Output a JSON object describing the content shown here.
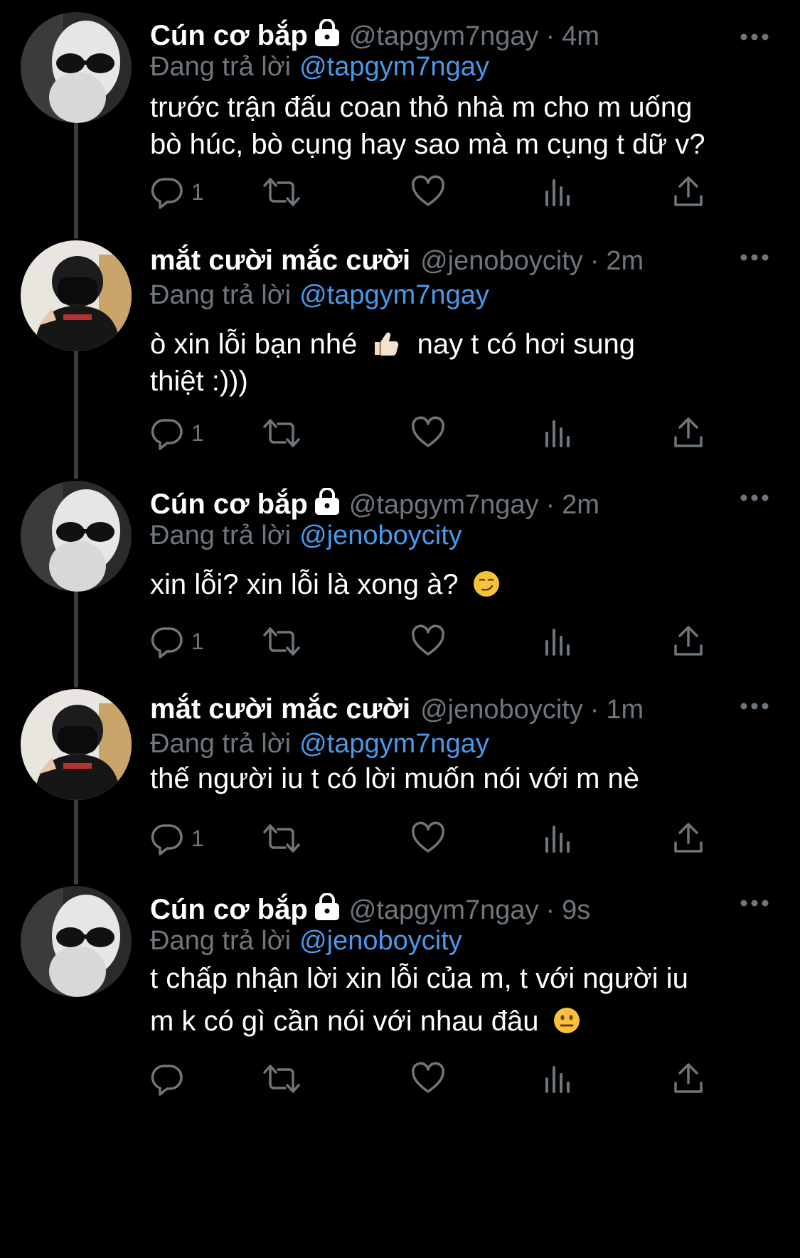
{
  "thread": {
    "tweets": [
      {
        "display_name": "Cún cơ bắp",
        "locked": true,
        "handle": "@tapgym7ngay",
        "dot": "·",
        "time": "4m",
        "reply_prefix": "Đang trả lời",
        "reply_to": "@tapgym7ngay",
        "text_lines": [
          "trước trận đấu coan thỏ nhà m cho m uống",
          "bò húc, bò cụng hay sao mà m cụng t dữ v?"
        ],
        "reply_count": "1",
        "avatar": "dog-avatar"
      },
      {
        "display_name": "mắt cười mắc cười",
        "locked": false,
        "handle": "@jenoboycity",
        "dot": "·",
        "time": "2m",
        "reply_prefix": "Đang trả lời",
        "reply_to": "@tapgym7ngay",
        "text_lines": [
          "ò xin lỗi bạn nhé",
          "nay t có hơi sung",
          "thiệt :)))"
        ],
        "reply_count": "1",
        "avatar": "person-avatar"
      },
      {
        "display_name": "Cún cơ bắp",
        "locked": true,
        "handle": "@tapgym7ngay",
        "dot": "·",
        "time": "2m",
        "reply_prefix": "Đang trả lời",
        "reply_to": "@jenoboycity",
        "text_lines": [
          "xin lỗi? xin lỗi là xong à?"
        ],
        "reply_count": "1",
        "avatar": "dog-avatar"
      },
      {
        "display_name": "mắt cười mắc cười",
        "locked": false,
        "handle": "@jenoboycity",
        "dot": "·",
        "time": "1m",
        "reply_prefix": "Đang trả lời",
        "reply_to": "@tapgym7ngay",
        "text_lines": [
          "thế người iu t có lời muốn nói với m nè"
        ],
        "reply_count": "1",
        "avatar": "person-avatar"
      },
      {
        "display_name": "Cún cơ bắp",
        "locked": true,
        "handle": "@tapgym7ngay",
        "dot": "·",
        "time": "9s",
        "reply_prefix": "Đang trả lời",
        "reply_to": "@jenoboycity",
        "text_lines": [
          "t chấp nhận lời xin lỗi của m, t với người iu",
          "m k có gì cần nói với nhau đâu"
        ],
        "reply_count": "",
        "avatar": "dog-avatar"
      }
    ]
  },
  "colors": {
    "background": "#000000",
    "primary_text": "#ffffff",
    "secondary_text": "#6e767d",
    "link": "#4a99e9",
    "thread_line": "#3a3d41"
  },
  "icons": [
    "lock-icon",
    "more-icon",
    "reply-icon",
    "retweet-icon",
    "like-icon",
    "analytics-icon",
    "share-icon",
    "thumbs-up-emoji",
    "smirk-emoji",
    "neutral-face-emoji"
  ]
}
